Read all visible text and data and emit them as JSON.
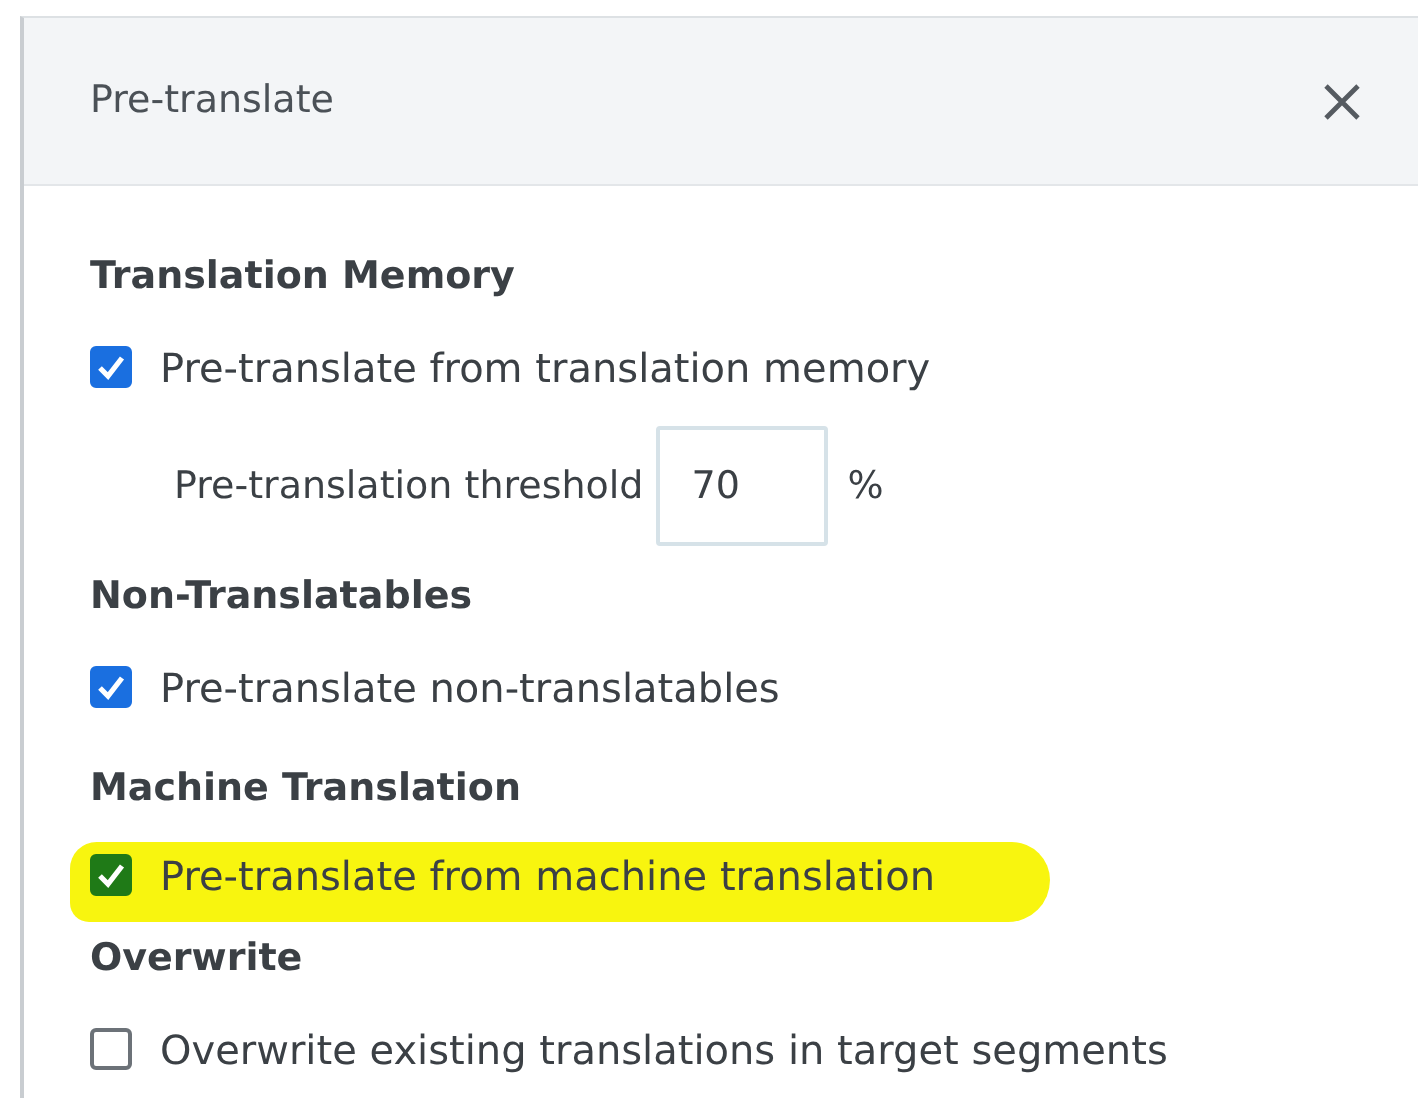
{
  "dialog": {
    "title": "Pre-translate"
  },
  "sections": [
    {
      "heading": "Translation Memory",
      "items": [
        {
          "kind": "checkbox",
          "label": "Pre-translate from translation memory",
          "checked": true,
          "highlighted": false
        },
        {
          "kind": "number",
          "label": "Pre-translation threshold",
          "value": "70",
          "unit": "%"
        }
      ]
    },
    {
      "heading": "Non-Translatables",
      "items": [
        {
          "kind": "checkbox",
          "label": "Pre-translate non-translatables",
          "checked": true,
          "highlighted": false
        }
      ]
    },
    {
      "heading": "Machine Translation",
      "items": [
        {
          "kind": "checkbox",
          "label": "Pre-translate from machine translation",
          "checked": true,
          "highlighted": true
        }
      ]
    },
    {
      "heading": "Overwrite",
      "items": [
        {
          "kind": "checkbox",
          "label": "Overwrite existing translations in target segments",
          "checked": false,
          "highlighted": false
        }
      ]
    }
  ]
}
